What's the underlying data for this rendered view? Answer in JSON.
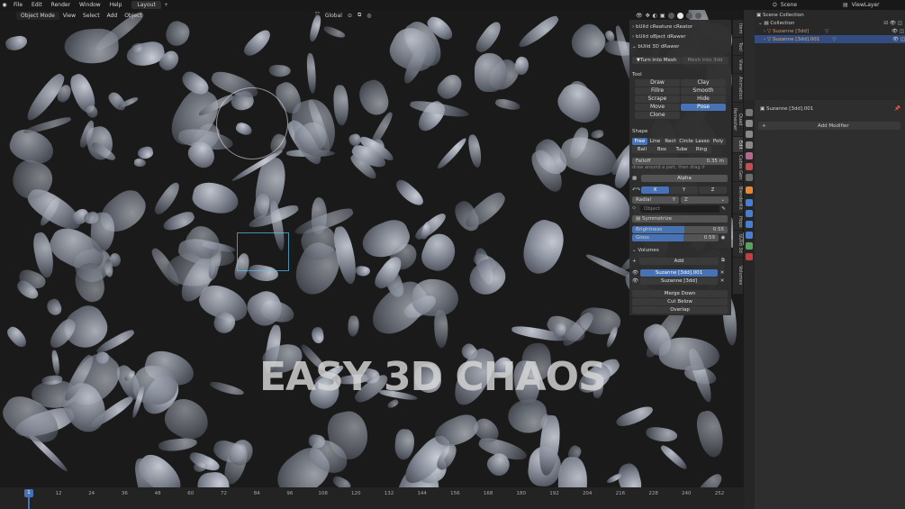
{
  "topbar": {
    "menus": [
      "File",
      "Edit",
      "Render",
      "Window",
      "Help"
    ],
    "workspace_tab": "Layout",
    "scene": "Scene",
    "view_layer": "ViewLayer"
  },
  "viewport_header": {
    "mode": "Object Mode",
    "menus": [
      "View",
      "Select",
      "Add",
      "Object"
    ],
    "orientation": "Global"
  },
  "overlay_title": "EASY 3D CHAOS",
  "side_tabs": [
    "Item",
    "Tool",
    "View",
    "Animation",
    "Quad Remesher",
    "Edit",
    "Cubes Gen",
    "BlenderKit",
    "Hops",
    "bUild 3d",
    "Volumes"
  ],
  "npanel": {
    "addons": [
      "bUild cReature cReator",
      "bUild oBject dRawer",
      "bUild 3D dRawer"
    ],
    "turn_into_mesh": "Turn into Mesh",
    "mesh_into_3dd": "Mesh into 3dd",
    "tool_header": "Tool",
    "tools": [
      "Draw",
      "Clay",
      "Fillre",
      "Smooth",
      "Scrape",
      "Hide",
      "Move",
      "Pose",
      "Clone"
    ],
    "active_tool": "Pose",
    "shape_header": "Shape",
    "shapes_row1": [
      "Free",
      "Line",
      "Rect",
      "Circle",
      "Lasso",
      "Poly"
    ],
    "shapes_row2": [
      "Ball",
      "Box",
      "Tube",
      "Ring"
    ],
    "active_shape": "Free",
    "falloff_label": "Falloff",
    "falloff_value": "0.35 m",
    "hint": "draw around a part, then drag it",
    "alpha_label": "Alpha",
    "axes": [
      "X",
      "Y",
      "Z"
    ],
    "radial_label": "Radial",
    "radial_axis1": "Y",
    "radial_axis2": "Z",
    "object_placeholder": "Object",
    "symmetrize": "Symmetrize",
    "brightness_label": "Brightness",
    "brightness_value": "0.55",
    "brightness_fraction": 0.55,
    "gloss_label": "Gloss",
    "gloss_value": "0.59",
    "gloss_fraction": 0.59,
    "volumes_header": "Volumes",
    "add_label": "Add",
    "volumes": [
      "Suzanne [3dd].001",
      "Suzanne [3dd]"
    ],
    "active_volume": "Suzanne [3dd].001",
    "merge_down": "Merge Down",
    "cut_below": "Cut Below",
    "overlap": "Overlap"
  },
  "outliner": {
    "root": "Scene Collection",
    "collection": "Collection",
    "items": [
      "Suzanne [3dd]",
      "Suzanne [3dd].001"
    ],
    "selected_item": "Suzanne [3dd].001"
  },
  "properties": {
    "object_name": "Suzanne [3dd].001",
    "add_modifier": "Add Modifier"
  },
  "timeline": {
    "current_frame": "1",
    "ticks": [
      "12",
      "24",
      "36",
      "48",
      "60",
      "72",
      "84",
      "96",
      "108",
      "120",
      "132",
      "144",
      "156",
      "168",
      "180",
      "192",
      "204",
      "216",
      "228",
      "240",
      "252"
    ]
  },
  "colors": {
    "accent_blue": "#4772b3",
    "panel_bg": "#2e2e2e",
    "viewport_bg": "#1a1a1a"
  }
}
